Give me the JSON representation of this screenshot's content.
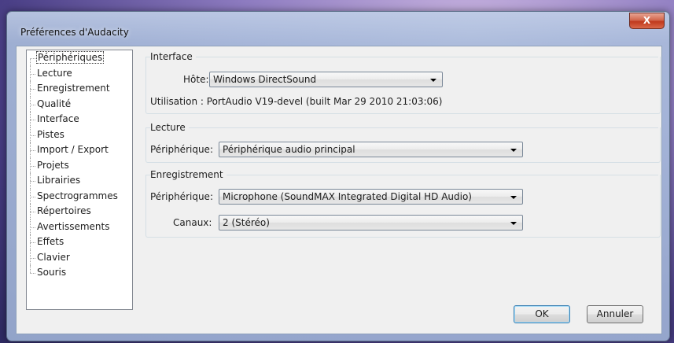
{
  "window": {
    "title": "Préférences d'Audacity",
    "close_label": "X"
  },
  "sidebar": {
    "items": [
      {
        "label": "Périphériques",
        "selected": true
      },
      {
        "label": "Lecture"
      },
      {
        "label": "Enregistrement"
      },
      {
        "label": "Qualité"
      },
      {
        "label": "Interface"
      },
      {
        "label": "Pistes"
      },
      {
        "label": "Import / Export"
      },
      {
        "label": "Projets"
      },
      {
        "label": "Librairies"
      },
      {
        "label": "Spectrogrammes"
      },
      {
        "label": "Répertoires"
      },
      {
        "label": "Avertissements"
      },
      {
        "label": "Effets"
      },
      {
        "label": "Clavier"
      },
      {
        "label": "Souris"
      }
    ]
  },
  "interface_group": {
    "title": "Interface",
    "host_label": "Hôte:",
    "host_value": "Windows DirectSound",
    "usage_text": "Utilisation : PortAudio V19-devel (built Mar 29 2010 21:03:06)"
  },
  "playback_group": {
    "title": "Lecture",
    "device_label": "Périphérique:",
    "device_value": "Périphérique audio principal"
  },
  "recording_group": {
    "title": "Enregistrement",
    "device_label": "Périphérique:",
    "device_value": "Microphone (SoundMAX Integrated Digital HD Audio)",
    "channels_label": "Canaux:",
    "channels_value": "2 (Stéréo)"
  },
  "buttons": {
    "ok_label": "OK",
    "cancel_label": "Annuler"
  }
}
